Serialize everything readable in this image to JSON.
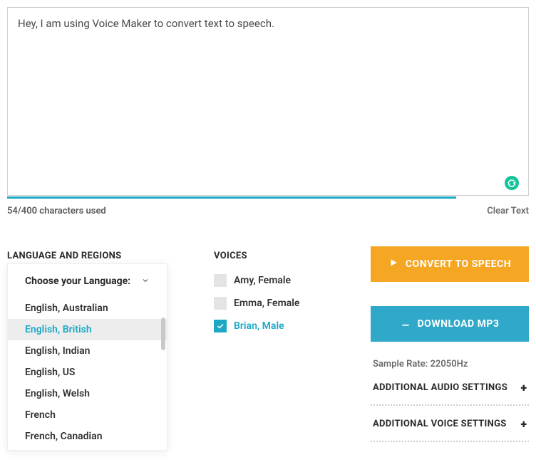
{
  "textarea": {
    "value": "Hey, I am using Voice Maker to convert text to speech."
  },
  "counter": "54/400 characters used",
  "clear_text": "Clear Text",
  "language_section": {
    "heading": "LANGUAGE AND REGIONS",
    "dropdown_label": "Choose your Language:",
    "items": [
      "English, Australian",
      "English, British",
      "English, Indian",
      "English, US",
      "English, Welsh",
      "French",
      "French, Canadian"
    ],
    "selected_index": 1
  },
  "voices_section": {
    "heading": "VOICES",
    "items": [
      {
        "label": "Amy, Female",
        "checked": false
      },
      {
        "label": "Emma, Female",
        "checked": false
      },
      {
        "label": "Brian, Male",
        "checked": true
      }
    ]
  },
  "actions": {
    "convert": "CONVERT TO SPEECH",
    "download": "DOWNLOAD MP3"
  },
  "sample_rate": "Sample Rate: 22050Hz",
  "settings": {
    "audio": "ADDITIONAL AUDIO SETTINGS",
    "voice": "ADDITIONAL VOICE SETTINGS"
  },
  "colors": {
    "accent": "#1ba8c4",
    "orange": "#f5a623",
    "teal_btn": "#2fa8c9"
  }
}
